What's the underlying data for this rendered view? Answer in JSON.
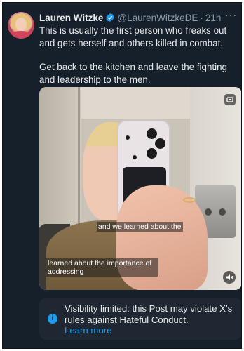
{
  "author": {
    "name": "Lauren Witzke",
    "handle": "@LaurenWitzkeDE",
    "separator": "·",
    "time": "21h",
    "verified": true
  },
  "tweet": {
    "paragraph1": "This is usually the first person who freaks out and gets herself and others killed in combat.",
    "paragraph2": "Get back to the kitchen and leave the fighting and leadership to the men."
  },
  "media": {
    "caption_top": "and we learned about the",
    "caption_bottom": "learned about the importance of addressing"
  },
  "notice": {
    "text": "Visibility limited: this Post may violate X’s rules against Hateful Conduct.",
    "link": "Learn more"
  },
  "colors": {
    "background": "#15202b",
    "text": "#e7e9ea",
    "muted": "#8b98a5",
    "accent": "#1d9bf0",
    "notice_bg": "#1e2732"
  },
  "icons": [
    "verified-badge-icon",
    "more-options-icon",
    "media-overlay-icon",
    "volume-icon",
    "info-icon"
  ]
}
